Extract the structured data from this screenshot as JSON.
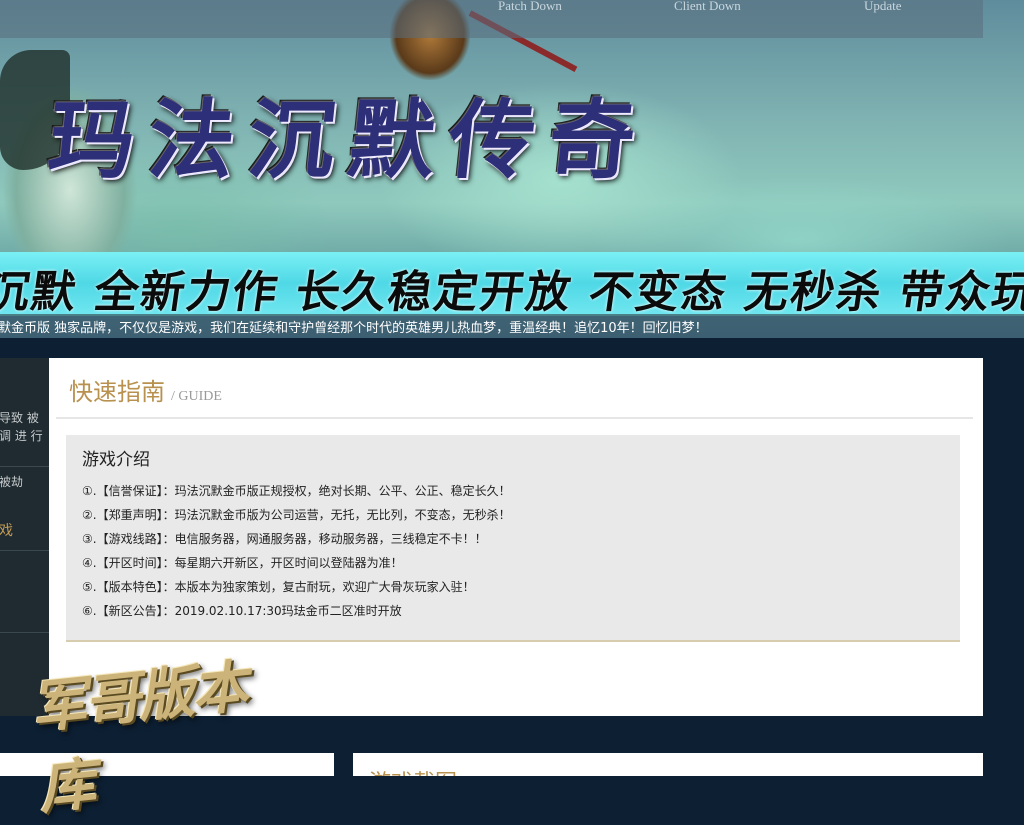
{
  "banner": {
    "nav": [
      "Patch Down",
      "Client Down",
      "Update"
    ],
    "title": "玛法沉默传奇",
    "slogan": "沉默 全新力作 长久稳定开放 不变态 无秒杀 带众玩家天宇",
    "marquee": "默金币版 独家品牌，不仅仅是游戏，我们在延续和守护曾经那个时代的英雄男儿热血梦，重温经典！追忆10年！回忆旧梦！"
  },
  "sidebar": {
    "text_1": "导致 被",
    "text_2": "调 进 行",
    "text_3": "被劫",
    "link": "戏"
  },
  "guide": {
    "title": "快速指南",
    "subtitle": "/ GUIDE",
    "intro_title": "游戏介绍",
    "items": [
      "①.【信誉保证】：玛法沉默金币版正规授权，绝对长期、公平、公正、稳定长久！",
      "②.【郑重声明】：玛法沉默金币版为公司运营，无托，无比列，不变态，无秒杀！",
      "③.【游戏线路】：电信服务器，网通服务器，移动服务器，三线稳定不卡！！",
      "④.【开区时间】：每星期六开新区，开区时间以登陆器为准！",
      "⑤.【版本特色】：本版本为独家策划，复古耐玩，欢迎广大骨灰玩家入驻！",
      "⑥.【新区公告】：2019.02.10.17:30玛珐金币二区准时开放"
    ]
  },
  "bottom": {
    "right_title": "游戏截图"
  },
  "watermark": {
    "text": "军哥版本库"
  },
  "colors": {
    "accent": "#b8914e",
    "page_bg": "#0d1f33",
    "sidebar_bg": "#1f2b30",
    "slogan_band": "#5fe4ee"
  }
}
